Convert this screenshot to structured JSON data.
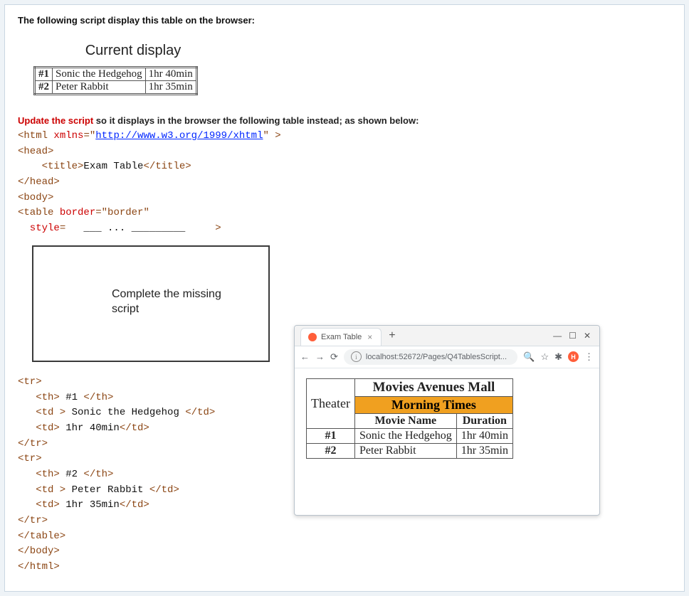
{
  "question": {
    "title": "The following script display this table on the browser:",
    "instruction_prefix": "Update the script",
    "instruction_rest": " so it displays in the browser the following table instead; as shown below:"
  },
  "current_display": {
    "caption": "Current display",
    "rows": [
      {
        "rank": "#1",
        "movie": "Sonic the Hedgehog",
        "duration": "1hr 40min"
      },
      {
        "rank": "#2",
        "movie": "Peter Rabbit",
        "duration": "1hr 35min"
      }
    ]
  },
  "code_top": {
    "l1_a": "<html ",
    "l1_b": "xmlns",
    "l1_c": "=\"",
    "l1_url": "http://www.w3.org/1999/xhtml",
    "l1_d": "\" >",
    "l2": "<head>",
    "l3_a": "    <title>",
    "l3_b": "Exam Table",
    "l3_c": "</title>",
    "l4": "</head>",
    "l5": "<body>",
    "l6_a": "<table ",
    "l6_b": "border",
    "l6_c": "=\"border\"",
    "l7_a": "  style",
    "l7_b": "=",
    "l7_gap": "   ___ ... _________     ",
    "l7_end": ">"
  },
  "blank_box": {
    "label_l1": "Complete the missing",
    "label_l2": "script"
  },
  "code_bottom": {
    "l1": "<tr>",
    "l2_a": "   <th>",
    "l2_b": " #1 ",
    "l2_c": "</th>",
    "l3_a": "   <td >",
    "l3_b": " Sonic the Hedgehog ",
    "l3_c": "</td>",
    "l4_a": "   <td>",
    "l4_b": " 1hr 40min",
    "l4_c": "</td>",
    "l5": "</tr>",
    "l6": "<tr>",
    "l7_a": "   <th>",
    "l7_b": " #2 ",
    "l7_c": "</th>",
    "l8_a": "   <td >",
    "l8_b": " Peter Rabbit ",
    "l8_c": "</td>",
    "l9_a": "   <td>",
    "l9_b": " 1hr 35min",
    "l9_c": "</td>",
    "l10": "</tr>",
    "l11": "</table>",
    "l12": "</body>",
    "l13": "</html>"
  },
  "browser": {
    "tab_title": "Exam Table",
    "tab_close": "×",
    "tab_plus": "+",
    "win_min": "—",
    "win_max": "☐",
    "win_close": "✕",
    "nav_back": "←",
    "nav_fwd": "→",
    "nav_reload": "⟳",
    "info": "i",
    "url": "localhost:52672/Pages/Q4TablesScript...",
    "zoom": "🔍",
    "star": "☆",
    "puzzle": "✱",
    "ext_letter": "H",
    "menu": "⋮"
  },
  "target_table": {
    "theater_label": "Theater",
    "mall": "Movies Avenues Mall",
    "morning": "Morning Times",
    "col_movie": "Movie Name",
    "col_dur": "Duration",
    "rows": [
      {
        "rank": "#1",
        "movie": "Sonic the Hedgehog",
        "duration": "1hr 40min"
      },
      {
        "rank": "#2",
        "movie": "Peter Rabbit",
        "duration": "1hr 35min"
      }
    ]
  }
}
